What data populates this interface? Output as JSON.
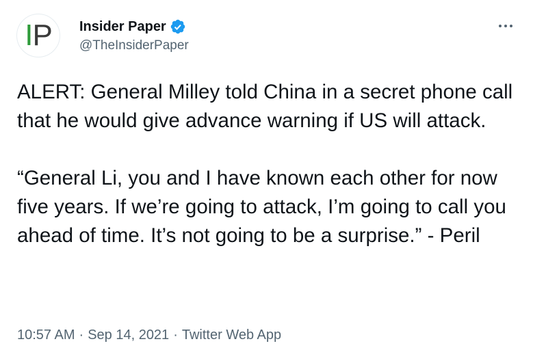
{
  "tweet": {
    "author": {
      "display_name": "Insider Paper",
      "handle": "@TheInsiderPaper",
      "verified": true,
      "avatar_text_i": "I",
      "avatar_text_p": "P"
    },
    "more_icon": "more-horizontal-icon",
    "paragraph_1": "ALERT: General Milley told China in a secret phone call that he would give advance warning if US will attack.",
    "paragraph_2": "“General Li, you and I have known each other for now five years. If we’re going to attack, I’m going to call you ahead of time. It’s not going to be a surprise.” - Peril",
    "meta": {
      "time": "10:57 AM",
      "separator": "·",
      "date": "Sep 14, 2021",
      "source": "Twitter Web App"
    }
  },
  "colors": {
    "text_primary": "#0f1419",
    "text_secondary": "#536471",
    "verified_blue": "#1d9bf0",
    "logo_green": "#2e9b3a"
  }
}
